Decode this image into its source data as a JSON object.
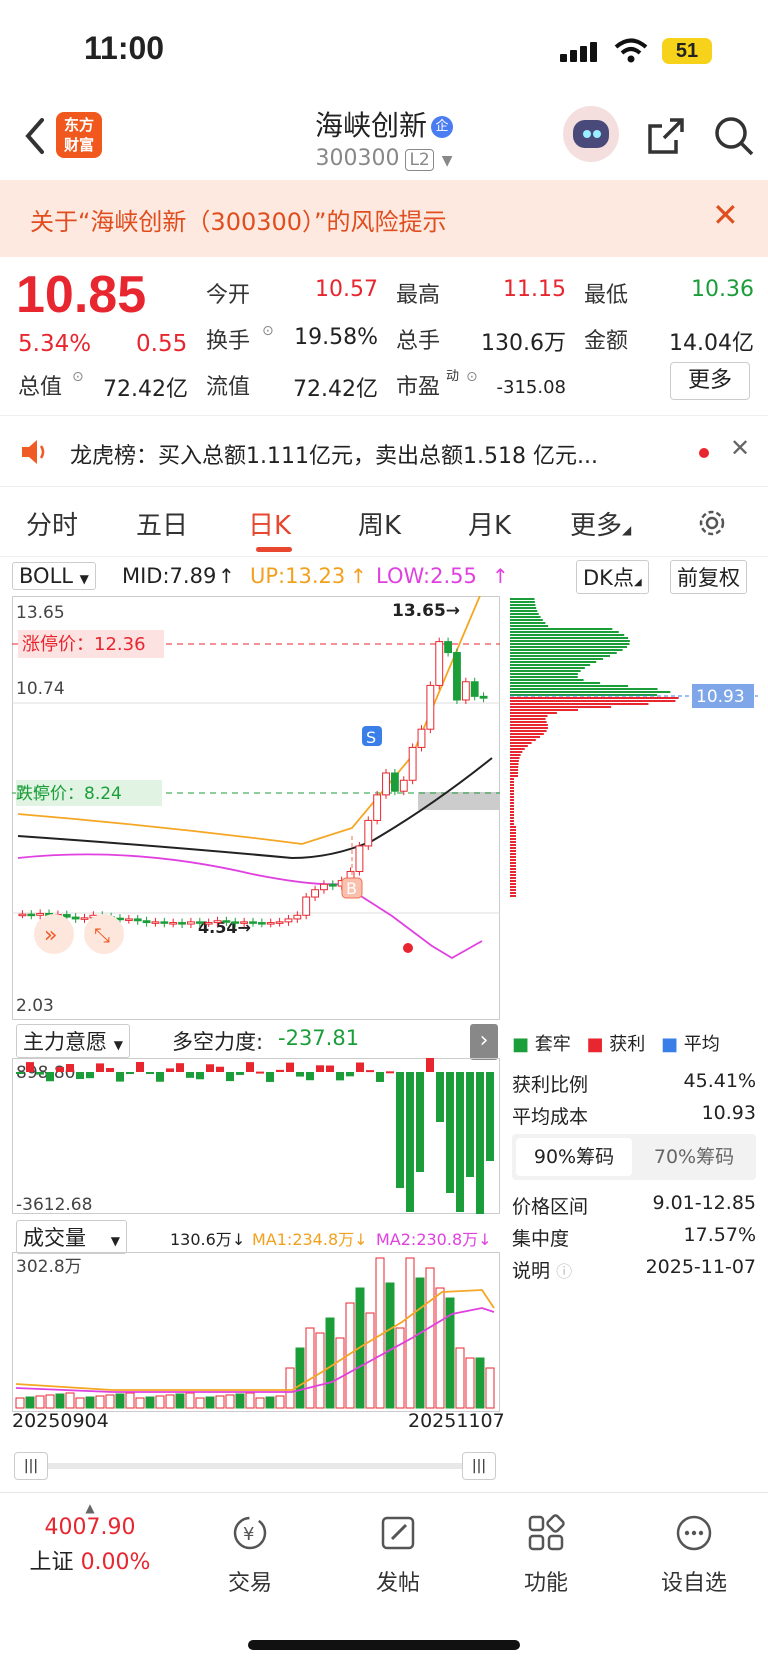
{
  "status": {
    "time": "11:00",
    "battery": "51"
  },
  "header": {
    "logo": "东方\n财富",
    "name": "海峡创新",
    "badge": "企",
    "code": "300300",
    "level": "L2"
  },
  "risk": {
    "text": "关于“海峡创新（300300）”的风险提示"
  },
  "quote": {
    "price": "10.85",
    "pct": "5.34%",
    "chg": "0.55",
    "labels": {
      "open": "今开",
      "high": "最高",
      "low": "最低",
      "turnover": "换手",
      "vol": "总手",
      "amount": "金额",
      "mcap": "总值",
      "float": "流值",
      "pe": "市盈",
      "pe_sup": "动",
      "more": "更多"
    },
    "values": {
      "open": "10.57",
      "high": "11.15",
      "low": "10.36",
      "turnover": "19.58%",
      "vol": "130.6万",
      "amount": "14.04亿",
      "mcap": "72.42亿",
      "float": "72.42亿",
      "pe": "-315.08"
    }
  },
  "lhb": {
    "text": "龙虎榜：买入总额1.111亿元，卖出总额1.518 亿元..."
  },
  "tabs": [
    "分时",
    "五日",
    "日K",
    "周K",
    "月K",
    "更多"
  ],
  "active_tab": "日K",
  "kchart": {
    "indicator": "BOLL",
    "mid": "MID:7.89",
    "up": "UP:13.23",
    "low": "LOW:2.55",
    "dk": "DK点",
    "adj": "前复权",
    "max": "13.65",
    "mid_line": "10.74",
    "min": "2.03",
    "high_label": "13.65",
    "low_label": "4.54",
    "limit_up": "涨停价：12.36",
    "limit_down": "跌停价：8.24",
    "limit_down_overlap": "7.5",
    "current": "10.93",
    "marks": [
      {
        "t": "S",
        "c": "#3a7ee8"
      },
      {
        "t": "B",
        "c": "#f07050"
      }
    ],
    "candles": [
      4.93,
      4.9,
      4.95,
      4.88,
      4.92,
      4.85,
      4.8,
      4.83,
      4.9,
      4.86,
      4.82,
      4.78,
      4.8,
      4.75,
      4.7,
      4.72,
      4.68,
      4.7,
      4.66,
      4.72,
      4.69,
      4.7,
      4.75,
      4.72,
      4.68,
      4.72,
      4.7,
      4.68,
      4.7,
      4.72,
      4.8,
      4.9,
      5.4,
      5.6,
      5.75,
      5.7,
      5.85,
      6.1,
      6.8,
      7.5,
      8.2,
      8.8,
      8.3,
      8.6,
      9.5,
      10.0,
      11.2,
      12.4,
      12.1,
      10.8,
      11.3,
      10.9,
      10.85
    ]
  },
  "force": {
    "indicator": "主力意愿",
    "label": "多空力度:",
    "value": "-237.81",
    "max": "898.80",
    "min": "-3612.68"
  },
  "volume": {
    "indicator": "成交量",
    "vol": "130.6万",
    "ma1": "MA1:234.8万",
    "ma2": "MA2:230.8万",
    "max": "302.8万",
    "start": "20250904",
    "end": "20251107"
  },
  "chips": {
    "legend": [
      "套牢",
      "获利",
      "平均"
    ],
    "legend_colors": [
      "#1b9e3a",
      "#e8262f",
      "#3a7ee8"
    ],
    "profit_ratio_label": "获利比例",
    "profit_ratio": "45.41%",
    "avg_cost_label": "平均成本",
    "avg_cost": "10.93",
    "tab90": "90%筹码",
    "tab70": "70%筹码",
    "range_label": "价格区间",
    "range": "9.01-12.85",
    "conc_label": "集中度",
    "conc": "17.57%",
    "note_label": "说明",
    "date": "2025-11-07"
  },
  "bottom": {
    "index_value": "4007.90",
    "index_name": "上证",
    "index_pct": "0.00%",
    "items": [
      "交易",
      "发帖",
      "功能",
      "设自选"
    ]
  }
}
